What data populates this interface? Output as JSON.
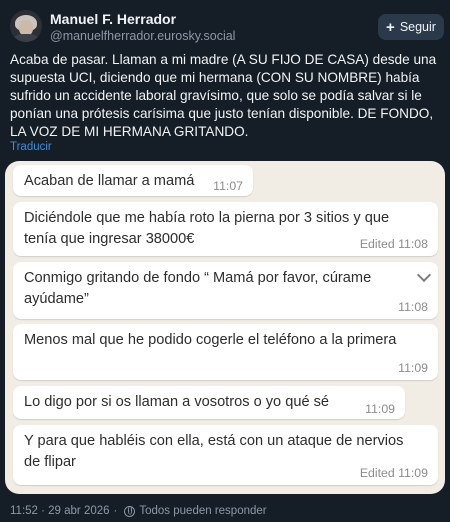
{
  "author": {
    "name": "Manuel F. Herrador",
    "handle": "@manuelfherrador.eurosky.social",
    "avatar_icon": "profile-photo"
  },
  "follow_button": {
    "label": "Seguir",
    "icon": "plus-icon"
  },
  "post": {
    "text": "Acaba de pasar. Llaman a mi madre (A SU FIJO DE CASA) desde una supuesta UCI, diciendo que mi hermana (CON SU NOMBRE) había sufrido un accidente laboral gravísimo, que solo se podía salvar si le ponían una prótesis carísima que justo tenían disponible. DE FONDO, LA VOZ DE MI HERMANA GRITANDO.",
    "translate_label": "Traducir"
  },
  "chat": {
    "background": "#f1ede5",
    "messages": [
      {
        "text": "Acaban de llamar a mamá",
        "time": "11:07"
      },
      {
        "text": "Diciéndole que me había roto la pierna por 3 sitios y que tenía que ingresar 38000€",
        "time": "Edited 11:08"
      },
      {
        "text": "Conmigo gritando de fondo “ Mamá por favor, cúrame ayúdame”",
        "time": "11:08"
      },
      {
        "text": "Menos mal que he podido cogerle el teléfono a la primera",
        "time": "11:09"
      },
      {
        "text": "Lo digo por si os llaman a vosotros o yo qué sé",
        "time": "11:09"
      },
      {
        "text": "Y para que habléis con ella, está con un ataque de nervios de flipar",
        "time": "Edited 11:09"
      }
    ]
  },
  "footer": {
    "datetime": "11:52 · 29 abr 2026",
    "separator": "·",
    "reply_setting": "Todos pueden responder"
  },
  "colors": {
    "background": "#151e27",
    "accent_link": "#3b8de0",
    "muted_text": "#8d98a5"
  }
}
